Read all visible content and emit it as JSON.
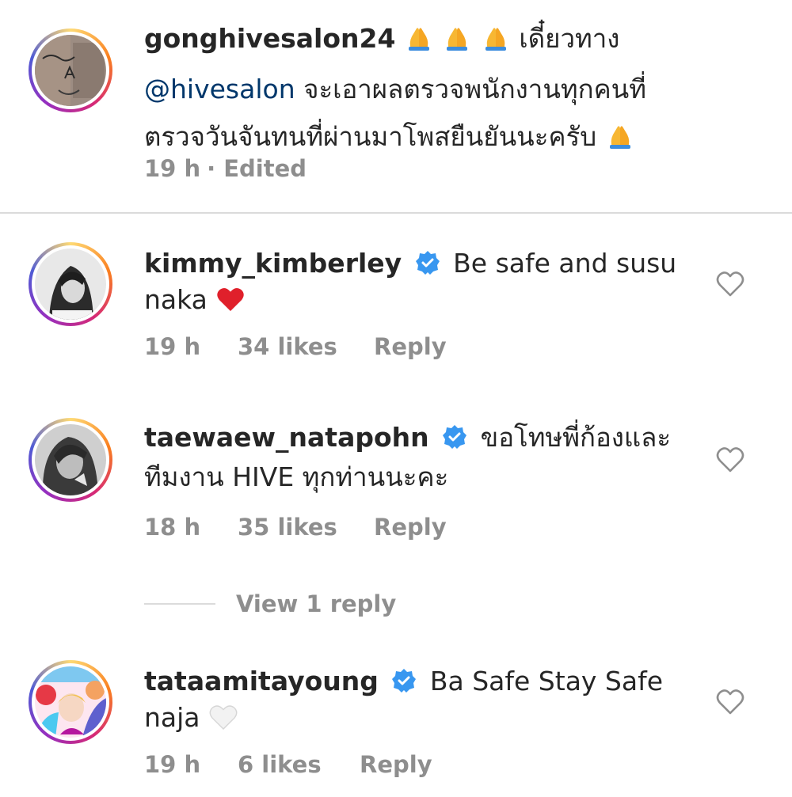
{
  "caption": {
    "username": "gonghivesalon24",
    "text_line1_after": "เดี๋ยวทาง",
    "mention": "@hivesalon",
    "text_line2_after": "จะเอาผลตรวจพนักงานทุกคนที่",
    "text_line3": "ตรวจวันจันทนที่ผ่านมาโพสยืนยันนะครับ",
    "time": "19 h",
    "edited": "· Edited"
  },
  "comments": [
    {
      "username": "kimmy_kimberley",
      "text_line1": "Be safe and susu",
      "text_line2": "naka",
      "time": "19 h",
      "likes": "34 likes",
      "reply": "Reply"
    },
    {
      "username": "taewaew_natapohn",
      "text_line1": "ขอโทษพี่ก้องและ",
      "text_line2": "ทีมงาน HIVE ทุกท่านนะคะ",
      "time": "18 h",
      "likes": "35 likes",
      "reply": "Reply",
      "view_replies": "View 1 reply"
    },
    {
      "username": "tataamitayoung",
      "text_line1": "Ba Safe Stay Safe",
      "text_line2": "naja",
      "time": "19 h",
      "likes": "6 likes",
      "reply": "Reply"
    }
  ],
  "icons": {
    "like": "heart-outline-icon",
    "verified": "verified-badge-icon",
    "pray": "folded-hands-emoji",
    "red_heart": "red-heart-emoji",
    "white_heart": "white-heart-emoji"
  },
  "colors": {
    "verified_blue": "#3897f0",
    "mention": "#00376b",
    "meta_gray": "#8e8e8e",
    "text": "#262626"
  }
}
